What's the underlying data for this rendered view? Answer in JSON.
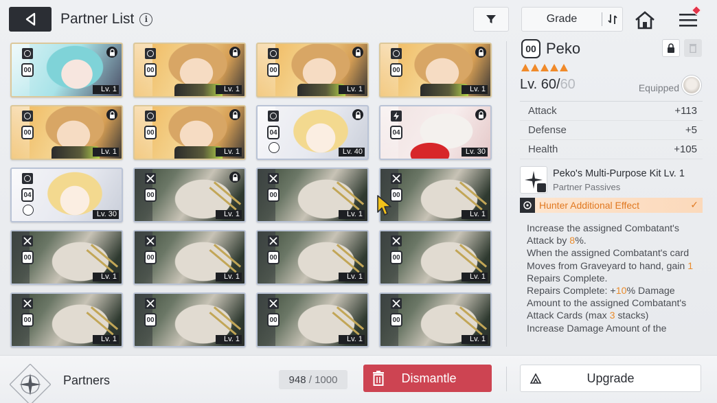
{
  "header": {
    "title": "Partner List",
    "sort_label": "Grade"
  },
  "cards": [
    {
      "art": "cyan",
      "frame": "gold",
      "class_icon": "ring-icon",
      "cost": "00",
      "level": "Lv. 1",
      "locked": true
    },
    {
      "art": "peko",
      "frame": "gold",
      "class_icon": "ring-icon",
      "cost": "00",
      "level": "Lv. 1",
      "locked": true
    },
    {
      "art": "peko",
      "frame": "gold",
      "class_icon": "ring-icon",
      "cost": "00",
      "level": "Lv. 1",
      "locked": true
    },
    {
      "art": "peko",
      "frame": "gold",
      "class_icon": "ring-icon",
      "cost": "00",
      "level": "Lv. 1",
      "locked": true
    },
    {
      "art": "peko",
      "frame": "gold",
      "class_icon": "ring-icon",
      "cost": "00",
      "level": "Lv. 1",
      "locked": true
    },
    {
      "art": "peko",
      "frame": "gold",
      "class_icon": "ring-icon",
      "cost": "00",
      "level": "Lv. 1",
      "locked": true
    },
    {
      "art": "blonde",
      "frame": "blue",
      "class_icon": "ring-icon",
      "cost": "04",
      "level": "Lv. 40",
      "locked": true
    },
    {
      "art": "fox",
      "frame": "blue",
      "class_icon": "bolt-icon",
      "cost": "04",
      "level": "Lv. 30",
      "locked": true
    },
    {
      "art": "blonde",
      "frame": "blue",
      "class_icon": "ring-icon",
      "cost": "04",
      "level": "Lv. 30",
      "locked": false
    },
    {
      "art": "grunt",
      "frame": "blue",
      "class_icon": "swords-icon",
      "cost": "00",
      "level": "Lv. 1",
      "locked": true
    },
    {
      "art": "grunt",
      "frame": "blue",
      "class_icon": "swords-icon",
      "cost": "00",
      "level": "Lv. 1",
      "locked": false
    },
    {
      "art": "grunt",
      "frame": "blue",
      "class_icon": "swords-icon",
      "cost": "00",
      "level": "Lv. 1",
      "locked": false
    },
    {
      "art": "grunt",
      "frame": "blue",
      "class_icon": "swords-icon",
      "cost": "00",
      "level": "Lv. 1",
      "locked": false
    },
    {
      "art": "grunt",
      "frame": "blue",
      "class_icon": "swords-icon",
      "cost": "00",
      "level": "Lv. 1",
      "locked": false
    },
    {
      "art": "grunt",
      "frame": "blue",
      "class_icon": "swords-icon",
      "cost": "00",
      "level": "Lv. 1",
      "locked": false
    },
    {
      "art": "grunt",
      "frame": "blue",
      "class_icon": "swords-icon",
      "cost": "00",
      "level": "Lv. 1",
      "locked": false
    },
    {
      "art": "grunt",
      "frame": "blue",
      "class_icon": "swords-icon",
      "cost": "00",
      "level": "Lv. 1",
      "locked": false
    },
    {
      "art": "grunt",
      "frame": "blue",
      "class_icon": "swords-icon",
      "cost": "00",
      "level": "Lv. 1",
      "locked": false
    },
    {
      "art": "grunt",
      "frame": "blue",
      "class_icon": "swords-icon",
      "cost": "00",
      "level": "Lv. 1",
      "locked": false
    },
    {
      "art": "grunt",
      "frame": "blue",
      "class_icon": "swords-icon",
      "cost": "00",
      "level": "Lv. 1",
      "locked": false
    }
  ],
  "detail": {
    "cost": "00",
    "name": "Peko",
    "stars": 5,
    "level_current": "Lv. 60/",
    "level_max": "60",
    "equipped_label": "Equipped",
    "stats": [
      {
        "label": "Attack",
        "value": "+113"
      },
      {
        "label": "Defense",
        "value": "+5"
      },
      {
        "label": "Health",
        "value": "+105"
      }
    ],
    "passive_name": "Peko's Multi-Purpose Kit Lv. 1",
    "passive_sub": "Partner Passives",
    "hunter_label": "Hunter Additional Effect",
    "description": [
      [
        {
          "t": "Increase the assigned Combatant's Attack by "
        },
        {
          "t": "8",
          "hl": true
        },
        {
          "t": "%."
        }
      ],
      [
        {
          "t": "When the assigned Combatant's card Moves from Graveyard to hand, gain "
        },
        {
          "t": "1",
          "hl": true
        },
        {
          "t": " Repairs Complete."
        }
      ],
      [
        {
          "t": "Repairs Complete: +"
        },
        {
          "t": "10",
          "hl": true
        },
        {
          "t": "% Damage Amount to the assigned Combatant's Attack Cards (max "
        },
        {
          "t": "3",
          "hl": true
        },
        {
          "t": " stacks)"
        }
      ],
      [
        {
          "t": "Increase Damage Amount of the assigned Combatant's Attack Cards"
        }
      ]
    ]
  },
  "footer": {
    "partners_label": "Partners",
    "count_current": "948",
    "count_max": " / 1000",
    "dismantle_label": "Dismantle",
    "upgrade_label": "Upgrade"
  },
  "colors": {
    "accent_orange": "#e07820",
    "dismantle_red": "#cd4452",
    "dark": "#2a2d33"
  }
}
